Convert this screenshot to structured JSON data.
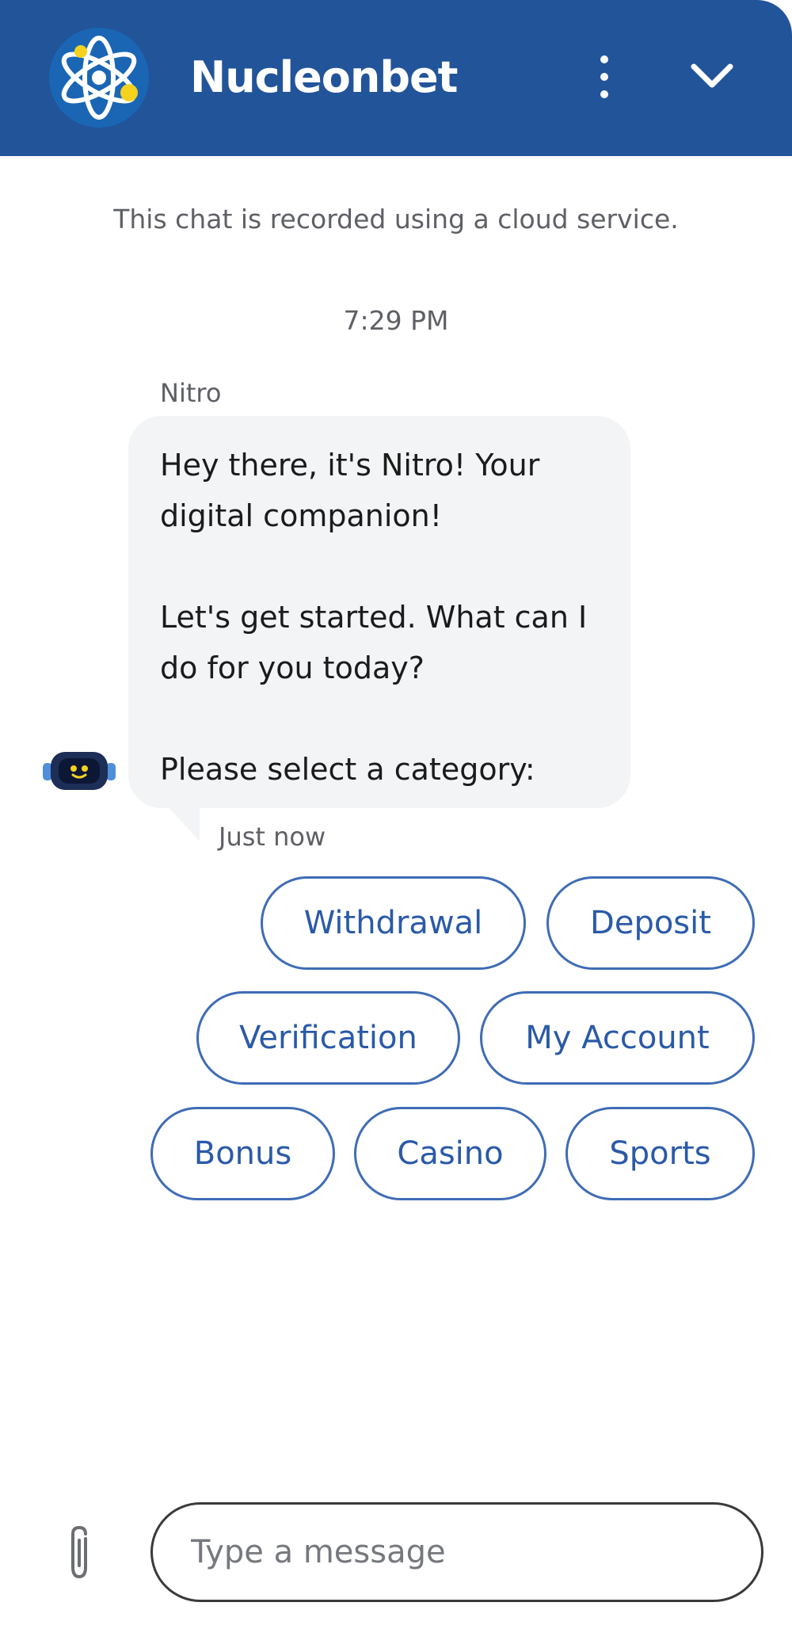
{
  "header": {
    "brand_name": "Nucleonbet",
    "logo_icon": "atom-icon",
    "menu_icon": "more-vertical-icon",
    "collapse_icon": "chevron-down-icon",
    "background_color": "#22549a"
  },
  "chat": {
    "recording_notice": "This chat is recorded using a cloud service.",
    "timestamp": "7:29 PM",
    "message": {
      "sender": "Nitro",
      "avatar_icon": "robot-avatar-icon",
      "paragraphs": [
        "Hey there, it's Nitro! Your digital companion!",
        "Let's get started. What can I do for you today?",
        "Please select a category:"
      ],
      "sent_label": "Just now"
    },
    "quick_replies": [
      "Withdrawal",
      "Deposit",
      "Verification",
      "My Account",
      "Bonus",
      "Casino",
      "Sports"
    ]
  },
  "composer": {
    "attach_icon": "paperclip-icon",
    "placeholder": "Type a message",
    "value": ""
  },
  "colors": {
    "accent": "#22549a",
    "chip_border": "#3f6cb5",
    "bubble_background": "#f2f4f6"
  }
}
